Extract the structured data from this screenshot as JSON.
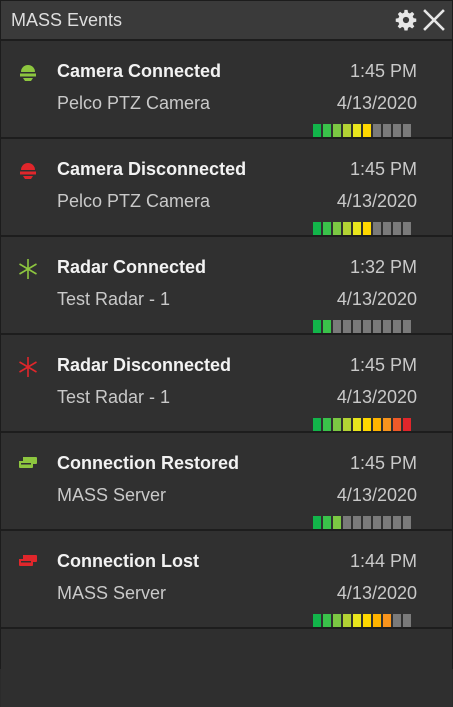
{
  "header": {
    "title": "MASS Events",
    "settings_icon": "gear-icon",
    "close_icon": "close-icon"
  },
  "colors": {
    "green": "#8dc63f",
    "red": "#e0262b",
    "segment_off": "#7a7a7a",
    "segment_colors": [
      "#12b54a",
      "#3ac24a",
      "#7bc843",
      "#b3d334",
      "#e9e61d",
      "#ffd800",
      "#ffb400",
      "#f7941d",
      "#ef5a29",
      "#e0262b"
    ]
  },
  "events": [
    {
      "title": "Camera Connected",
      "source": "Pelco PTZ Camera",
      "time": "1:45 PM",
      "date": "4/13/2020",
      "icon": "camera-connected-icon",
      "status": "green",
      "level": 6
    },
    {
      "title": "Camera Disconnected",
      "source": "Pelco PTZ Camera",
      "time": "1:45 PM",
      "date": "4/13/2020",
      "icon": "camera-disconnected-icon",
      "status": "red",
      "level": 6
    },
    {
      "title": "Radar Connected",
      "source": "Test Radar - 1",
      "time": "1:32 PM",
      "date": "4/13/2020",
      "icon": "radar-connected-icon",
      "status": "green",
      "level": 2
    },
    {
      "title": "Radar Disconnected",
      "source": "Test Radar - 1",
      "time": "1:45 PM",
      "date": "4/13/2020",
      "icon": "radar-disconnected-icon",
      "status": "red",
      "level": 10
    },
    {
      "title": "Connection Restored",
      "source": "MASS Server",
      "time": "1:45 PM",
      "date": "4/13/2020",
      "icon": "connection-restored-icon",
      "status": "green",
      "level": 3
    },
    {
      "title": "Connection Lost",
      "source": "MASS Server",
      "time": "1:44 PM",
      "date": "4/13/2020",
      "icon": "connection-lost-icon",
      "status": "red",
      "level": 8
    }
  ],
  "meter_segments": 10
}
